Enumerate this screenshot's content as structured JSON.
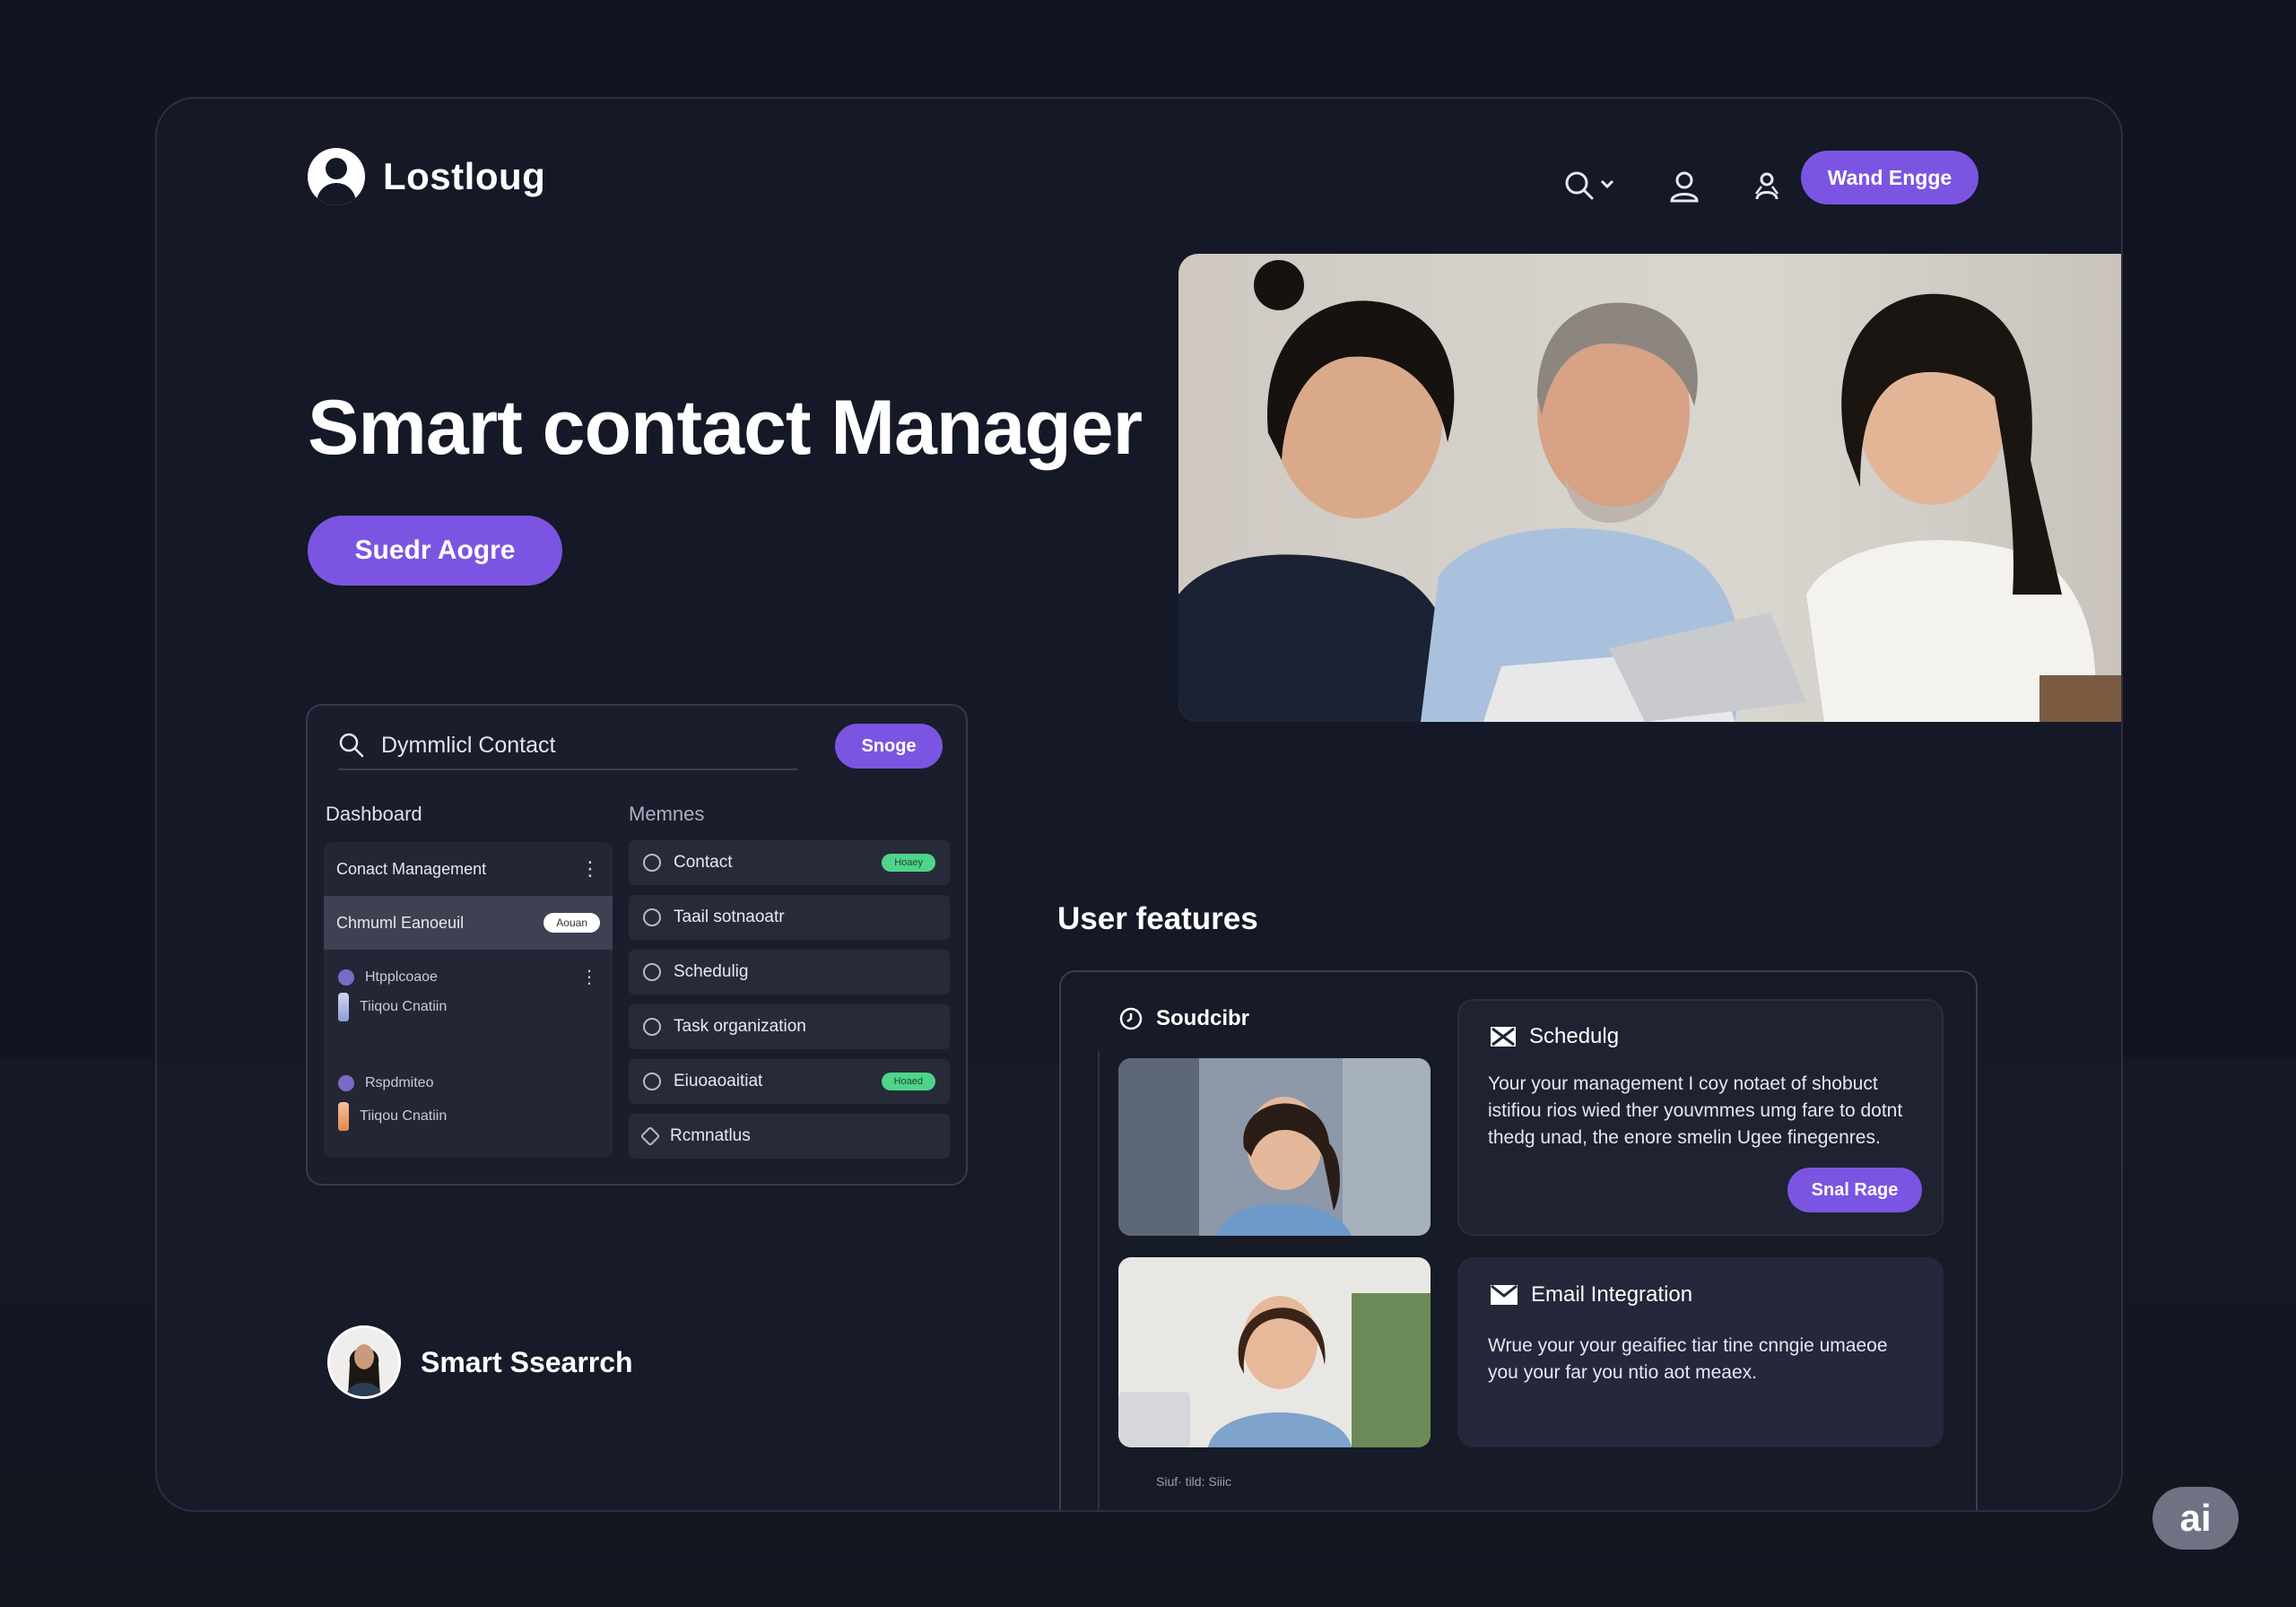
{
  "brand": {
    "name": "Lostloug",
    "logo_icon": "user-avatar-icon"
  },
  "nav": {
    "icons": [
      "search-icon",
      "chevron-down-icon",
      "user-icon",
      "profile-icon"
    ],
    "cta_label": "Wand Engge"
  },
  "hero": {
    "title": "Smart contact Manager",
    "cta_label": "Suedr Aogre"
  },
  "dashboard": {
    "search_value": "Dymmlicl Contact",
    "button_label": "Snoge",
    "left_title": "Dashboard",
    "right_title": "Memnes",
    "left_rows": [
      {
        "label": "Conact Management",
        "more": "⋮"
      },
      {
        "label": "Chmuml Eanoeuil",
        "badge": "Aouan"
      }
    ],
    "left_items": [
      {
        "label": "Htpplcoaoe",
        "more": "⋮"
      },
      {
        "label": "Tiiqou Cnatiin"
      },
      {
        "label": "Rspdmiteo"
      },
      {
        "label": "Tiiqou Cnatiin"
      }
    ],
    "menu_items": [
      {
        "label": "Contact",
        "tag": "Hoaey"
      },
      {
        "label": "Taail sotnaoatr"
      },
      {
        "label": "Schedulig"
      },
      {
        "label": "Task organization"
      },
      {
        "label": "Eiuoaoaitiat",
        "tag": "Hoaed"
      },
      {
        "label": "Rcmnatlus"
      }
    ]
  },
  "smart_search": {
    "label": "Smart Ssearrch"
  },
  "user_features": {
    "title": "User features",
    "panel_header": "Soudcibr",
    "tiny_caption": "Siuf· tild: Siiic",
    "cards": [
      {
        "icon": "envelope-x-icon",
        "title": "Schedulg",
        "body": "Your your management I coy notaet of shobuct istifiou rios wied ther youvmmes umg fare to dotnt thedg unad, the enore smelin Ugee finegenres.",
        "button": "Snal Rage"
      },
      {
        "icon": "envelope-icon",
        "title": "Email Integration",
        "body": "Wrue your your geaifiec tiar tine cnngie umaeoe you your far you ntio aot meaex."
      }
    ]
  },
  "badge": {
    "label": "ai"
  },
  "colors": {
    "accent": "#7b55e2",
    "background": "#121421",
    "success": "#4fd48a"
  }
}
